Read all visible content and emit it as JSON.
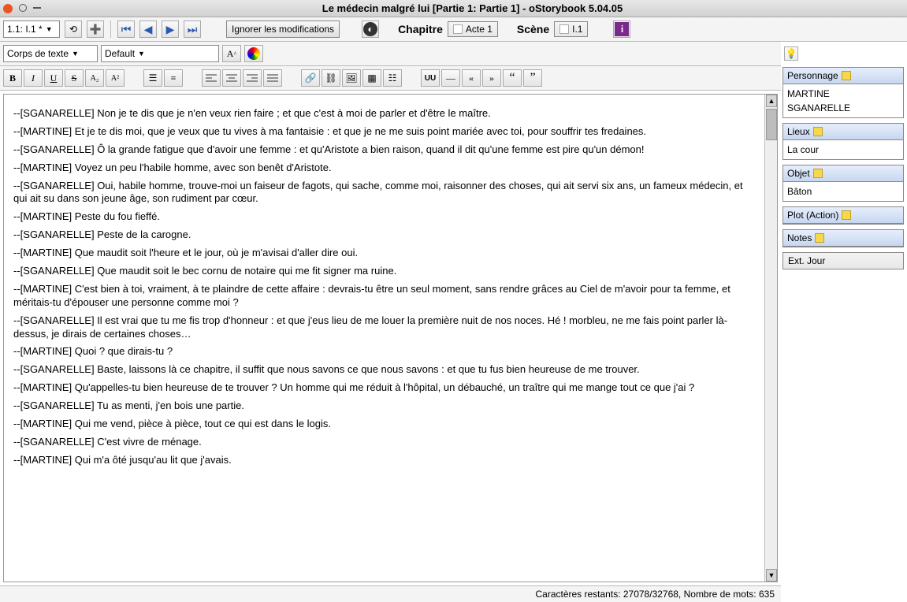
{
  "titlebar": {
    "title": "Le médecin malgré lui [Partie 1: Partie 1] - oStorybook 5.04.05"
  },
  "toolbar": {
    "sceneSelect": "1.1: I.1 *",
    "ignore": "Ignorer les modifications",
    "chapter": "Chapitre",
    "chapterChip": "Acte 1",
    "scene": "Scène",
    "sceneChip": "I.1"
  },
  "fmt": {
    "style": "Corps de texte",
    "font": "Default"
  },
  "content": {
    "lines": [
      "--[SGANARELLE] Non je te dis que je n'en veux rien faire ; et que c'est à moi de parler et d'être le maître.",
      "--[MARTINE] Et je te dis moi, que je veux que tu vives à ma fantaisie : et que je ne me suis point mariée avec toi, pour souffrir tes fredaines.",
      "--[SGANARELLE] Ô la grande fatigue que d'avoir une femme : et qu'Aristote a bien raison, quand il dit qu'une femme est pire qu'un démon!",
      "--[MARTINE] Voyez un peu l'habile homme, avec son benêt d'Aristote.",
      "--[SGANARELLE] Oui, habile homme, trouve-moi un faiseur de fagots, qui sache, comme moi, raisonner des choses, qui ait servi six ans, un fameux médecin, et qui ait su dans son jeune âge, son rudiment par cœur.",
      "--[MARTINE] Peste du fou fieffé.",
      "--[SGANARELLE] Peste de la carogne.",
      "--[MARTINE] Que maudit soit l'heure et le jour, où je m'avisai d'aller dire oui.",
      "--[SGANARELLE] Que maudit soit le bec cornu de notaire qui me fit signer ma ruine.",
      "--[MARTINE] C'est bien à toi, vraiment, à te plaindre de cette affaire : devrais-tu être un seul moment, sans rendre grâces au Ciel de m'avoir pour ta femme, et méritais-tu d'épouser une personne comme moi ?",
      "--[SGANARELLE] Il est vrai que tu me fis trop d'honneur : et que j'eus lieu de me louer la première nuit de nos noces. Hé ! morbleu, ne me fais point parler là-dessus, je dirais de certaines choses…",
      "--[MARTINE] Quoi ? que dirais-tu ?",
      "--[SGANARELLE] Baste, laissons là ce chapitre, il suffit que nous savons ce que nous savons : et que tu fus bien heureuse de me trouver.",
      "--[MARTINE] Qu'appelles-tu bien heureuse de te trouver ? Un homme qui me réduit à l'hôpital, un débauché, un traître qui me mange tout ce que j'ai ?",
      "--[SGANARELLE] Tu as menti, j'en bois une partie.",
      "--[MARTINE] Qui me vend, pièce à pièce, tout ce qui est dans le logis.",
      "--[SGANARELLE] C'est vivre de ménage.",
      "--[MARTINE] Qui m'a ôté jusqu'au lit que j'avais."
    ]
  },
  "status": "Caractères restants: 27078/32768, Nombre de mots: 635",
  "side": {
    "p_hdr": "Personnage",
    "chars": [
      "MARTINE",
      "SGANARELLE"
    ],
    "l_hdr": "Lieux",
    "locs": [
      "La cour"
    ],
    "o_hdr": "Objet",
    "objs": [
      "Bâton"
    ],
    "plot_hdr": "Plot (Action)",
    "notes_hdr": "Notes",
    "ext": "Ext. Jour"
  }
}
